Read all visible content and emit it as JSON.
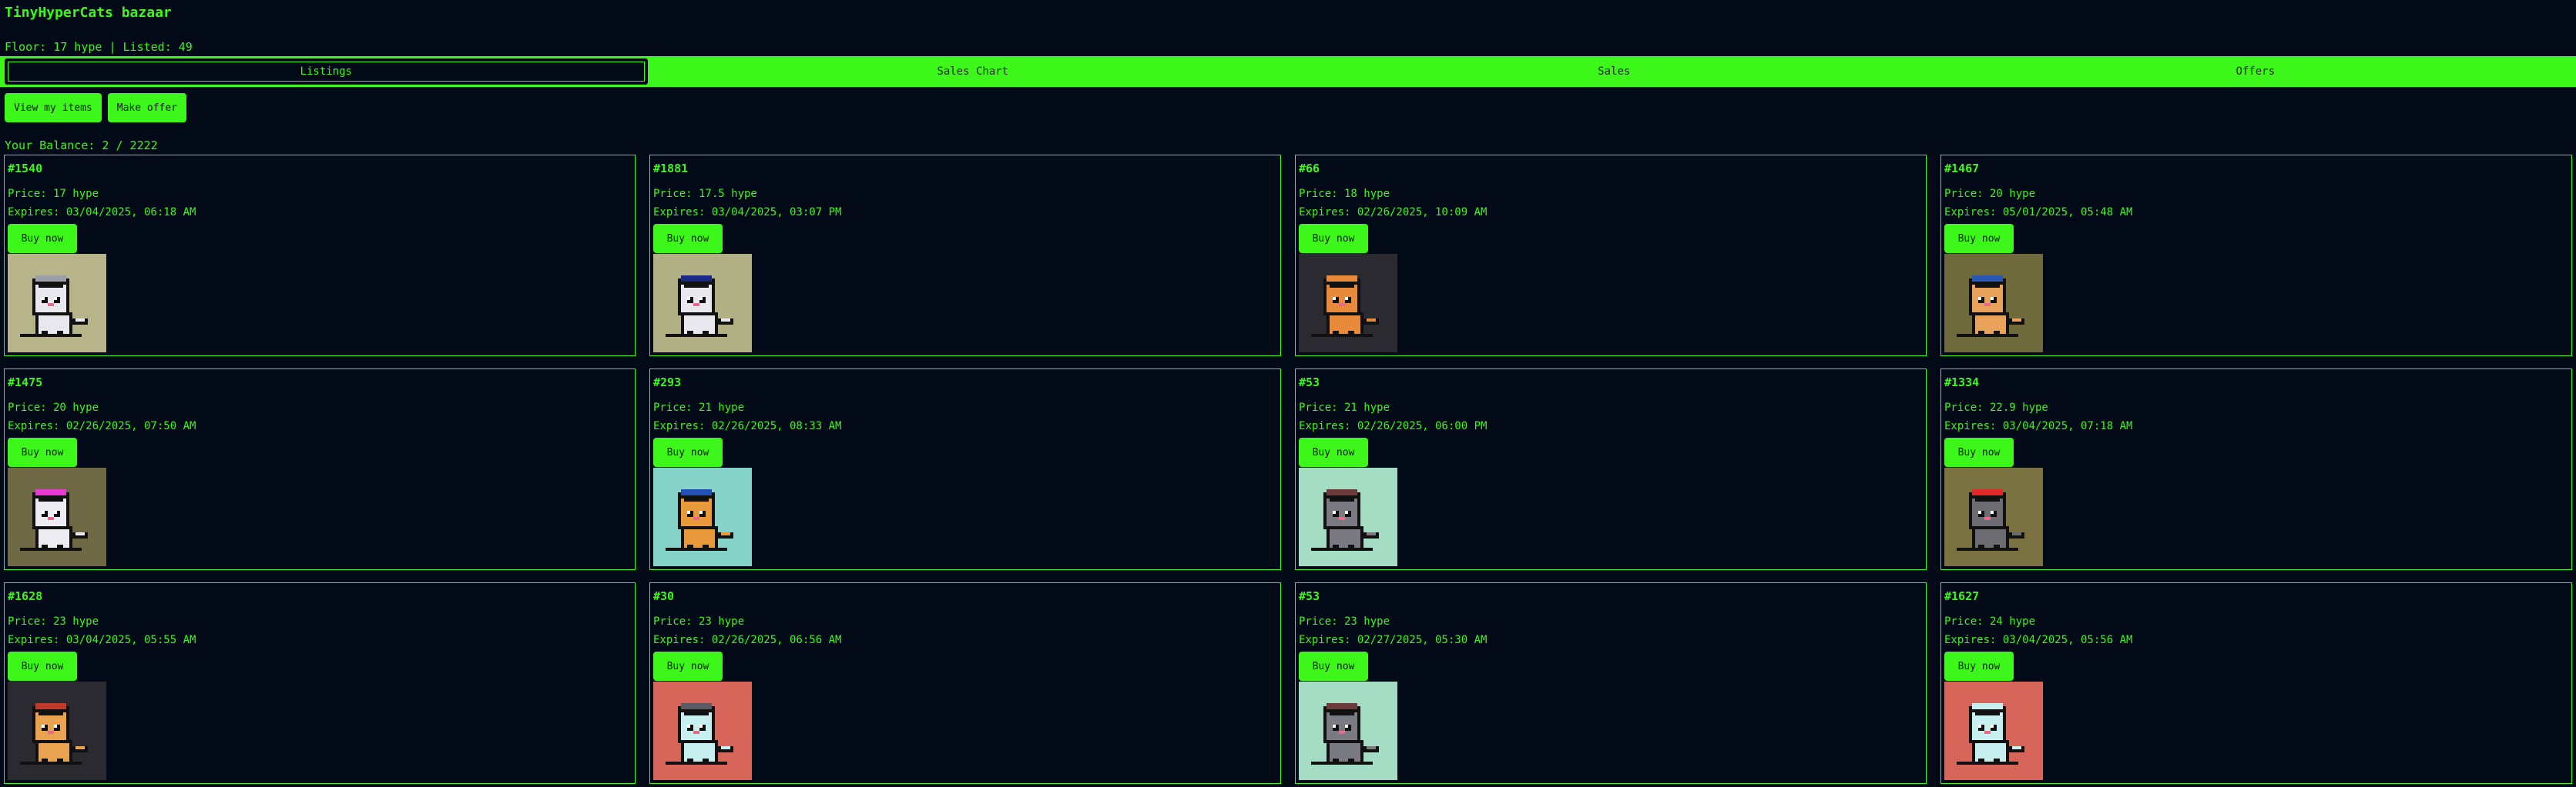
{
  "header": {
    "title": "TinyHyperCats bazaar",
    "stats": "Floor: 17 hype | Listed: 49"
  },
  "tabs": [
    {
      "label": "Listings",
      "active": true
    },
    {
      "label": "Sales Chart",
      "active": false
    },
    {
      "label": "Sales",
      "active": false
    },
    {
      "label": "Offers",
      "active": false
    }
  ],
  "actions": {
    "view_my_items": "View my items",
    "make_offer": "Make offer"
  },
  "balance": "Your Balance: 2 / 2222",
  "listings": [
    {
      "id": "#1540",
      "price": "Price: 17 hype",
      "expires": "Expires: 03/04/2025, 06:18 AM",
      "buy": "Buy now",
      "bg": "#b7b48a",
      "cat": "#e8e8ee",
      "hat": "#9aa0aa"
    },
    {
      "id": "#1881",
      "price": "Price: 17.5 hype",
      "expires": "Expires: 03/04/2025, 03:07 PM",
      "buy": "Buy now",
      "bg": "#b2b085",
      "cat": "#e8e8ee",
      "hat": "#1a2a86"
    },
    {
      "id": "#66",
      "price": "Price: 18 hype",
      "expires": "Expires: 02/26/2025, 10:09 AM",
      "buy": "Buy now",
      "bg": "#2a2a30",
      "cat": "#e88a3a",
      "hat": "#e88a3a"
    },
    {
      "id": "#1467",
      "price": "Price: 20 hype",
      "expires": "Expires: 05/01/2025, 05:48 AM",
      "buy": "Buy now",
      "bg": "#6f6a3c",
      "cat": "#e8a25a",
      "hat": "#2b58b5"
    },
    {
      "id": "#1475",
      "price": "Price: 20 hype",
      "expires": "Expires: 02/26/2025, 07:50 AM",
      "buy": "Buy now",
      "bg": "#6e6944",
      "cat": "#ececf2",
      "hat": "#e63ad2"
    },
    {
      "id": "#293",
      "price": "Price: 21 hype",
      "expires": "Expires: 02/26/2025, 08:33 AM",
      "buy": "Buy now",
      "bg": "#86d3c9",
      "cat": "#e89a3a",
      "hat": "#2452b4"
    },
    {
      "id": "#53",
      "price": "Price: 21 hype",
      "expires": "Expires: 02/26/2025, 06:00 PM",
      "buy": "Buy now",
      "bg": "#a5dcc4",
      "cat": "#7a7a82",
      "hat": "#6b3a3a"
    },
    {
      "id": "#1334",
      "price": "Price: 22.9 hype",
      "expires": "Expires: 03/04/2025, 07:18 AM",
      "buy": "Buy now",
      "bg": "#7a7240",
      "cat": "#6c6c72",
      "hat": "#e22a2a"
    },
    {
      "id": "#1628",
      "price": "Price: 23 hype",
      "expires": "Expires: 03/04/2025, 05:55 AM",
      "buy": "Buy now",
      "bg": "#2a2a30",
      "cat": "#e8a250",
      "hat": "#c23a2a"
    },
    {
      "id": "#30",
      "price": "Price: 23 hype",
      "expires": "Expires: 02/26/2025, 06:56 AM",
      "buy": "Buy now",
      "bg": "#d8655a",
      "cat": "#c8f0f0",
      "hat": "#5a5a62"
    },
    {
      "id": "#53",
      "price": "Price: 23 hype",
      "expires": "Expires: 02/27/2025, 05:30 AM",
      "buy": "Buy now",
      "bg": "#a5dcc4",
      "cat": "#7a7a82",
      "hat": "#6b3a3a"
    },
    {
      "id": "#1627",
      "price": "Price: 24 hype",
      "expires": "Expires: 03/04/2025, 05:56 AM",
      "buy": "Buy now",
      "bg": "#d8655a",
      "cat": "#c8f0f0",
      "hat": "#c8f0f0"
    }
  ]
}
